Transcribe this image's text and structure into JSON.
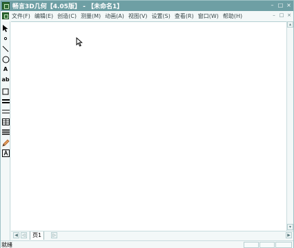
{
  "window": {
    "title": "畅言3D几何【4.05版】 - 【未命名1】",
    "minimize_glyph": "–",
    "maximize_glyph": "□",
    "close_glyph": "×"
  },
  "menu": {
    "items": [
      {
        "label": "文件(F)"
      },
      {
        "label": "编辑(E)"
      },
      {
        "label": "创造(C)"
      },
      {
        "label": "测量(M)"
      },
      {
        "label": "动画(A)"
      },
      {
        "label": "视图(V)"
      },
      {
        "label": "设置(S)"
      },
      {
        "label": "查看(R)"
      },
      {
        "label": "窗口(W)"
      },
      {
        "label": "帮助(H)"
      }
    ],
    "doc_minimize_glyph": "–",
    "doc_restore_glyph": "□",
    "doc_close_glyph": "×"
  },
  "toolbox": {
    "tools": [
      {
        "name": "select-arrow-tool-icon"
      },
      {
        "name": "point-tool-icon"
      },
      {
        "name": "line-tool-icon"
      },
      {
        "name": "circle-tool-icon"
      },
      {
        "name": "text-tool-icon",
        "label": "A"
      },
      {
        "name": "label-tool-icon",
        "label": "ab"
      },
      {
        "name": "rectangle-tool-icon"
      },
      {
        "name": "thick-line-tool-icon"
      },
      {
        "name": "parallel-lines-tool-icon"
      },
      {
        "name": "grid-tool-icon"
      },
      {
        "name": "stack-lines-tool-icon"
      },
      {
        "name": "pencil-tool-icon"
      },
      {
        "name": "text-box-tool-icon"
      }
    ]
  },
  "pages": {
    "current_tab": "页1",
    "nav_first": "◀",
    "nav_prev": "◁",
    "nav_next": "▷",
    "nav_last": "▶"
  },
  "scrollbar": {
    "up_glyph": "▴",
    "down_glyph": "▾"
  },
  "status": {
    "text": "就绪"
  },
  "colors": {
    "titlebar": "#6e9fa4",
    "frame": "#9fc2c6",
    "chrome": "#f3f8f8",
    "canvas": "#ffffff",
    "menu_text": "#38474a",
    "tool_accent": "#d07a3a"
  }
}
